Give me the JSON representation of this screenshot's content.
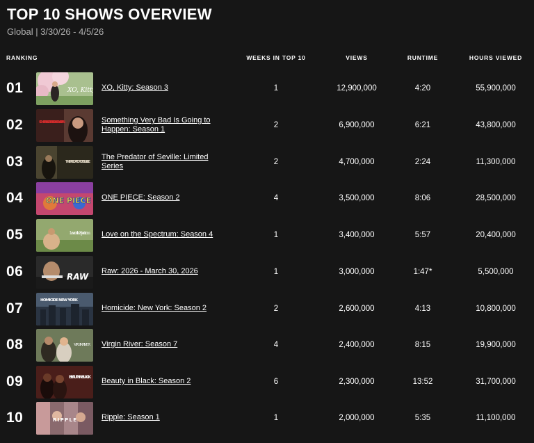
{
  "header": {
    "title": "TOP 10 SHOWS OVERVIEW",
    "subtitle": "Global | 3/30/26 - 4/5/26"
  },
  "columns": {
    "ranking": "RANKING",
    "weeks": "WEEKS IN TOP 10",
    "views": "VIEWS",
    "runtime": "RUNTIME",
    "hours": "HOURS VIEWED"
  },
  "rows": [
    {
      "rank": "01",
      "title": "XO, Kitty: Season 3",
      "weeks": "1",
      "views": "12,900,000",
      "runtime": "4:20",
      "hours": "55,900,000"
    },
    {
      "rank": "02",
      "title": "Something Very Bad Is Going to Happen: Season 1",
      "weeks": "2",
      "views": "6,900,000",
      "runtime": "6:21",
      "hours": "43,800,000"
    },
    {
      "rank": "03",
      "title": "The Predator of Seville: Limited Series",
      "weeks": "2",
      "views": "4,700,000",
      "runtime": "2:24",
      "hours": "11,300,000"
    },
    {
      "rank": "04",
      "title": "ONE PIECE: Season 2",
      "weeks": "4",
      "views": "3,500,000",
      "runtime": "8:06",
      "hours": "28,500,000"
    },
    {
      "rank": "05",
      "title": "Love on the Spectrum: Season 4",
      "weeks": "1",
      "views": "3,400,000",
      "runtime": "5:57",
      "hours": "20,400,000"
    },
    {
      "rank": "06",
      "title": "Raw: 2026 - March 30, 2026",
      "weeks": "1",
      "views": "3,000,000",
      "runtime": "1:47*",
      "hours": "5,500,000"
    },
    {
      "rank": "07",
      "title": "Homicide: New York: Season 2",
      "weeks": "2",
      "views": "2,600,000",
      "runtime": "4:13",
      "hours": "10,800,000"
    },
    {
      "rank": "08",
      "title": "Virgin River: Season 7",
      "weeks": "4",
      "views": "2,400,000",
      "runtime": "8:15",
      "hours": "19,900,000"
    },
    {
      "rank": "09",
      "title": "Beauty in Black: Season 2",
      "weeks": "6",
      "views": "2,300,000",
      "runtime": "13:52",
      "hours": "31,700,000"
    },
    {
      "rank": "10",
      "title": "Ripple: Season 1",
      "weeks": "1",
      "views": "2,000,000",
      "runtime": "5:35",
      "hours": "11,100,000"
    }
  ],
  "thumbnails": {
    "t1": {
      "text": "XO, Kitty",
      "bg": "#9fb88a"
    },
    "t2": {
      "text": "SOMETHING VERY BAD IS GOING TO HAPPEN",
      "bg": "#3a1f1c"
    },
    "t3": {
      "text": "THE PREDATOR OF SEVILLE",
      "bg": "#2e2a1c"
    },
    "t4": {
      "text": "ONE PIECE",
      "bg": "#b5436a"
    },
    "t5": {
      "text": "Love on the Spectrum",
      "bg": "#8fa36a"
    },
    "t6": {
      "text": "RAW",
      "bg": "#2a2a2a"
    },
    "t7": {
      "text": "HOMICIDE NEW YORK",
      "bg": "#34404f"
    },
    "t8": {
      "text": "VIRGIN RIVER",
      "bg": "#6b7659"
    },
    "t9": {
      "text": "BEAUTY IN BLACK",
      "bg": "#4a1e1a"
    },
    "t10": {
      "text": "RIPPLE",
      "bg": "#a07a7a"
    }
  }
}
